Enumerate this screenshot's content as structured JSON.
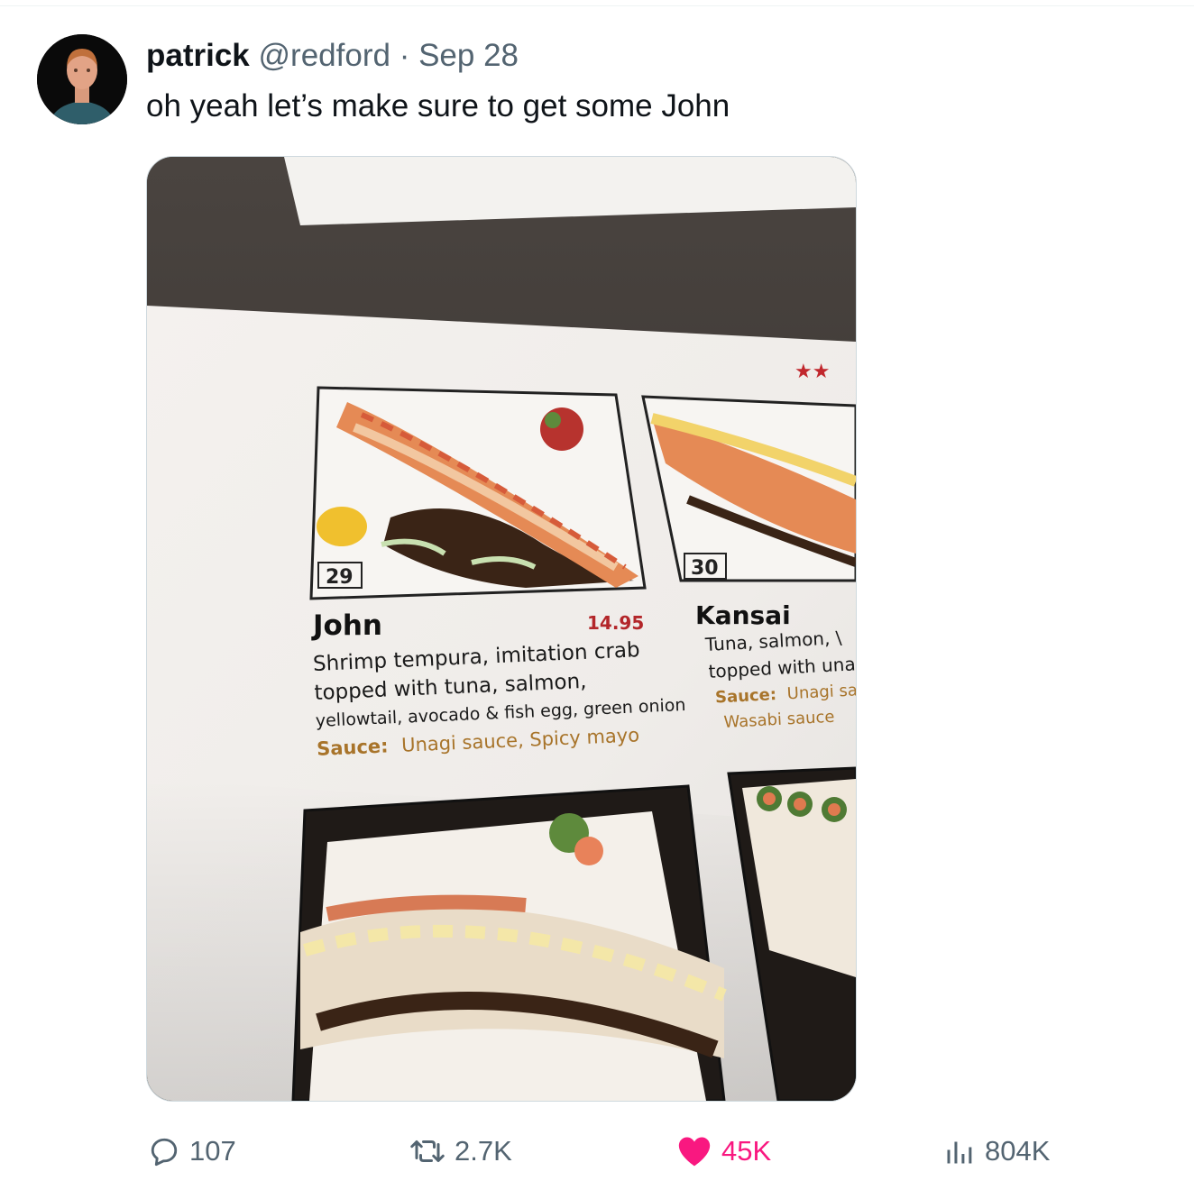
{
  "tweet": {
    "display_name": "patrick",
    "handle": "@redford",
    "separator": "·",
    "date": "Sep 28",
    "text": "oh yeah let’s make sure to get some John"
  },
  "menu_photo": {
    "stars": "★★",
    "items": [
      {
        "number": "29",
        "name": "John",
        "price": "14.95",
        "desc_line1": "Shrimp tempura, imitation crab",
        "desc_line2": "topped with tuna, salmon,",
        "desc_line3": "yellowtail, avocado & fish egg, green onion",
        "sauce_label": "Sauce:",
        "sauce_text": "Unagi sauce, Spicy mayo"
      },
      {
        "number": "30",
        "name": "Kansai",
        "desc_line1": "Tuna, salmon, \\",
        "desc_line2": "topped with unac",
        "sauce_label": "Sauce:",
        "sauce_text": "Unagi sa",
        "desc_line4": "Wasabi sauce"
      }
    ]
  },
  "actions": {
    "replies": "107",
    "retweets": "2.7K",
    "likes": "45K",
    "views": "804K"
  },
  "colors": {
    "like": "#f91880",
    "muted": "#536471",
    "text": "#0f1419"
  }
}
